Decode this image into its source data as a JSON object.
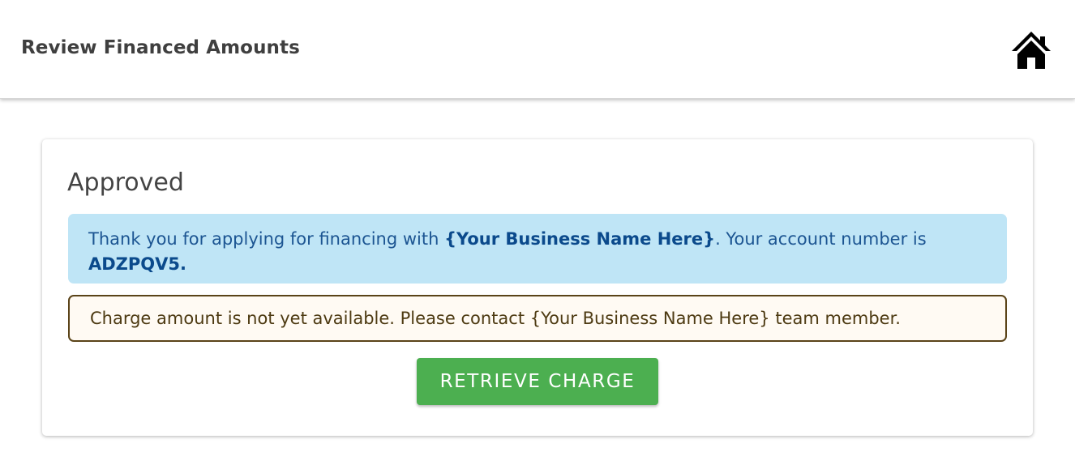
{
  "header": {
    "title": "Review Financed Amounts",
    "home_icon": "home-icon"
  },
  "card": {
    "title": "Approved",
    "info": {
      "text_before": "Thank you for applying for financing with ",
      "business_name": "{Your Business Name Here}",
      "text_middle": ". Your account number is ",
      "account_number": "ADZPQV5."
    },
    "warning": {
      "text": "Charge amount is not yet available. Please contact {Your Business Name Here} team member."
    },
    "retrieve_button": {
      "label": "RETRIEVE CHARGE",
      "color": "#4caf50"
    }
  },
  "colors": {
    "info_background": "#bfe5f6",
    "info_text": "#1c5592",
    "warning_background": "#fffaf3",
    "warning_border": "#5a4318"
  }
}
